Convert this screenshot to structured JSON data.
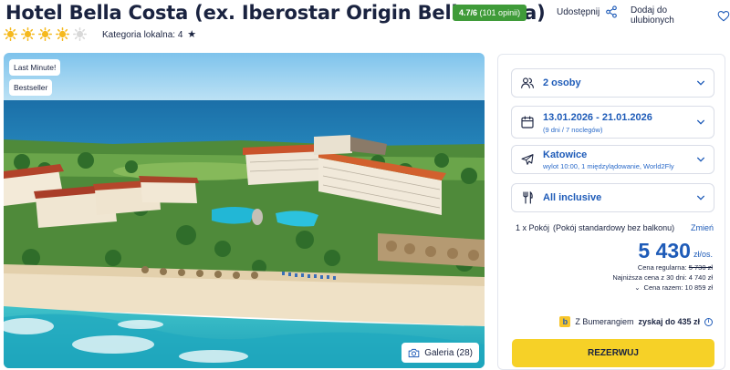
{
  "header": {
    "title": "Hotel Bella Costa (ex. Iberostar Origin Bella Costa)",
    "rating_score": "4.7/6",
    "rating_count": "(101 opinii)",
    "sun_rating": 4,
    "sun_total": 5,
    "local_category": "Kategoria lokalna: 4",
    "share_label": "Udostępnij",
    "favorite_label": "Dodaj do ulubionych"
  },
  "photo": {
    "tags": [
      "Last Minute!",
      "Bestseller"
    ],
    "gallery_label": "Galeria (28)"
  },
  "booking": {
    "persons": "2 osoby",
    "dates": "13.01.2026 - 21.01.2026",
    "dates_sub": "(9 dni / 7 noclegów)",
    "departure": "Katowice",
    "departure_sub": "wylot 10:00, 1 międzylądowanie, World2Fly",
    "board": "All inclusive",
    "room_count": "1 x Pokój",
    "room_type": "(Pokój standardowy bez balkonu)",
    "change_label": "Zmień",
    "price": "5 430",
    "price_unit": "zł/os.",
    "regular_price_label": "Cena regularna:",
    "regular_price": "5 730 zł",
    "lowest_price": "Najniższa cena z 30 dni: 4 740 zł",
    "total_price": "Cena razem: 10 859 zł",
    "boomerang_prefix": "Z Bumerangiem",
    "boomerang_bold": "zyskaj do 435 zł",
    "reserve_label": "REZERWUJ"
  },
  "colors": {
    "accent_blue": "#1e5bb8",
    "rating_green": "#3f9b39",
    "sun_yellow": "#f5b91e",
    "reserve_yellow": "#f6d127"
  }
}
